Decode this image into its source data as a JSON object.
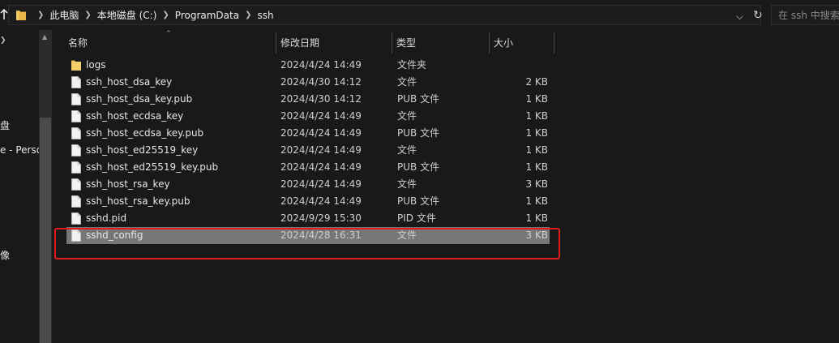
{
  "address_bar": {
    "crumbs": [
      "此电脑",
      "本地磁盘 (C:)",
      "ProgramData",
      "ssh"
    ]
  },
  "search": {
    "placeholder": "在 ssh 中搜索"
  },
  "nav_fragments": [
    "盘",
    "e - Perso",
    "像"
  ],
  "columns": {
    "name": "名称",
    "date": "修改日期",
    "type": "类型",
    "size": "大小"
  },
  "files": [
    {
      "name": "logs",
      "date": "2024/4/24 14:49",
      "type": "文件夹",
      "size": "",
      "icon": "folder-icon"
    },
    {
      "name": "ssh_host_dsa_key",
      "date": "2024/4/30 14:12",
      "type": "文件",
      "size": "2 KB",
      "icon": "file-icon"
    },
    {
      "name": "ssh_host_dsa_key.pub",
      "date": "2024/4/30 14:12",
      "type": "PUB 文件",
      "size": "1 KB",
      "icon": "file-icon"
    },
    {
      "name": "ssh_host_ecdsa_key",
      "date": "2024/4/24 14:49",
      "type": "文件",
      "size": "1 KB",
      "icon": "file-icon"
    },
    {
      "name": "ssh_host_ecdsa_key.pub",
      "date": "2024/4/24 14:49",
      "type": "PUB 文件",
      "size": "1 KB",
      "icon": "file-icon"
    },
    {
      "name": "ssh_host_ed25519_key",
      "date": "2024/4/24 14:49",
      "type": "文件",
      "size": "1 KB",
      "icon": "file-icon"
    },
    {
      "name": "ssh_host_ed25519_key.pub",
      "date": "2024/4/24 14:49",
      "type": "PUB 文件",
      "size": "1 KB",
      "icon": "file-icon"
    },
    {
      "name": "ssh_host_rsa_key",
      "date": "2024/4/24 14:49",
      "type": "文件",
      "size": "3 KB",
      "icon": "file-icon"
    },
    {
      "name": "ssh_host_rsa_key.pub",
      "date": "2024/4/24 14:49",
      "type": "PUB 文件",
      "size": "1 KB",
      "icon": "file-icon"
    },
    {
      "name": "sshd.pid",
      "date": "2024/9/29 15:30",
      "type": "PID 文件",
      "size": "1 KB",
      "icon": "file-icon"
    },
    {
      "name": "sshd_config",
      "date": "2024/4/28 16:31",
      "type": "文件",
      "size": "3 KB",
      "icon": "file-icon",
      "selected": true
    }
  ],
  "colors": {
    "background": "#191919",
    "selection": "#777777",
    "folder": "#e8b84a",
    "annotation": "#e21b1b"
  }
}
